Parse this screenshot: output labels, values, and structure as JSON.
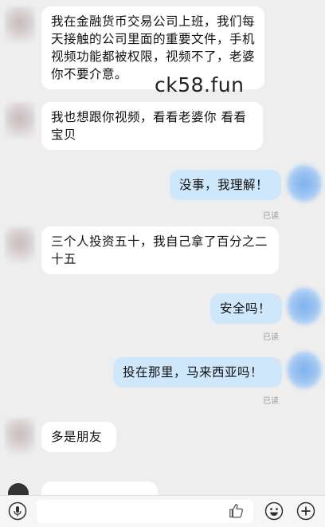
{
  "messages": [
    {
      "side": "left",
      "text": "我在金融货币交易公司上班，我们每天接触的公司里面的重要文件，手机视频功能都被权限，视频不了，老婆你不要介意。"
    },
    {
      "side": "left",
      "text": "我也想跟你视频，看看老婆你 看看宝贝"
    },
    {
      "side": "right",
      "text": "没事，我理解！",
      "status": "已读"
    },
    {
      "side": "left",
      "text": "三个人投资五十，我自己拿了百分之二十五"
    },
    {
      "side": "right",
      "text": "安全吗！",
      "status": "已读"
    },
    {
      "side": "right",
      "text": "投在那里，马来西亚吗！",
      "status": "已读"
    },
    {
      "side": "left",
      "text": "多是朋友"
    }
  ],
  "watermark": "ck58.fun",
  "input_bar": {
    "icons": [
      "microphone-icon",
      "thumbs-up-icon",
      "emoji-icon",
      "plus-icon"
    ]
  }
}
